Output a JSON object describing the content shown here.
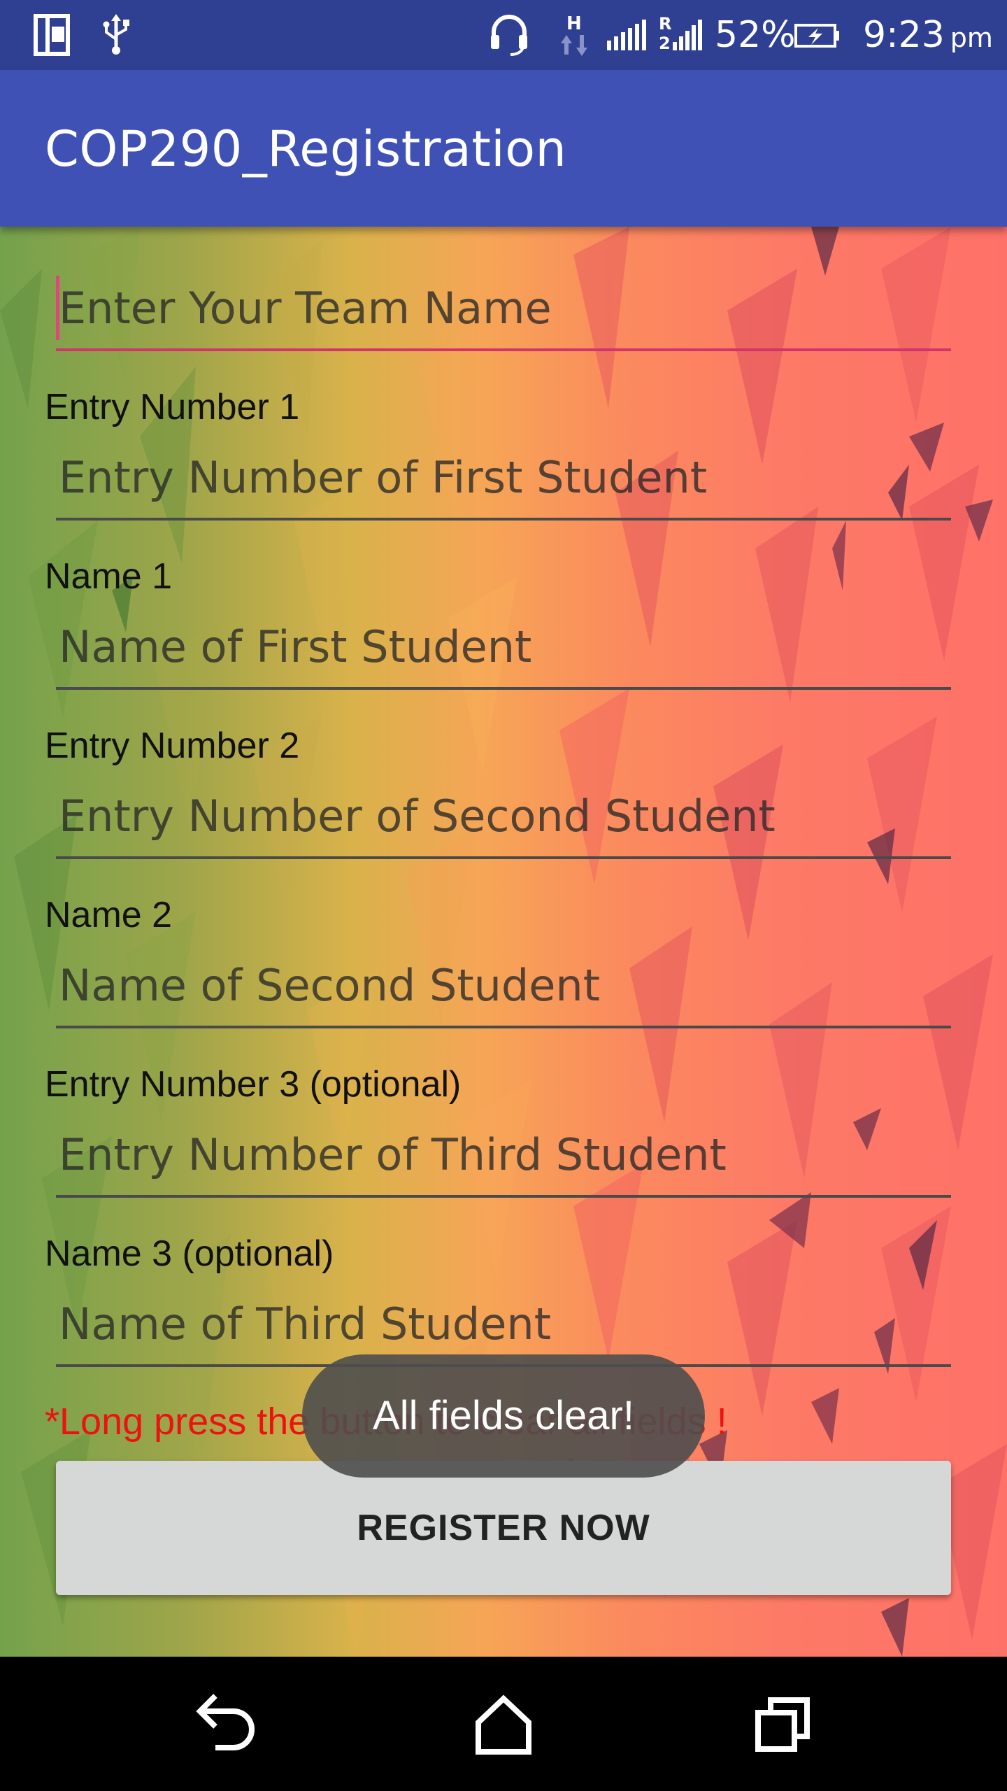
{
  "status_bar": {
    "battery_percent": "52%",
    "time": "9:23",
    "ampm": "pm",
    "icons": [
      "multi-window-icon",
      "usb-icon",
      "headset-icon",
      "h-data-icon",
      "signal-icon",
      "signal-r-icon",
      "battery-charging-icon"
    ]
  },
  "app_bar": {
    "title": "COP290_Registration"
  },
  "form": {
    "team_name": {
      "placeholder": "Enter Your Team Name"
    },
    "entry1": {
      "label": "Entry Number 1",
      "placeholder": "Entry Number of First Student"
    },
    "name1": {
      "label": "Name 1",
      "placeholder": "Name of First Student"
    },
    "entry2": {
      "label": "Entry Number 2",
      "placeholder": "Entry Number of Second Student"
    },
    "name2": {
      "label": "Name 2",
      "placeholder": "Name of Second Student"
    },
    "entry3": {
      "label": "Entry Number 3 (optional)",
      "placeholder": "Entry Number of Third Student"
    },
    "name3": {
      "label": "Name 3 (optional)",
      "placeholder": "Name of Third Student"
    },
    "hint": "*Long press the button to clear all fields !",
    "register_label": "REGISTER NOW"
  },
  "toast": {
    "message": "All fields clear!"
  },
  "nav_bar": {
    "icons": [
      "back-icon",
      "home-icon",
      "recents-icon"
    ]
  },
  "colors": {
    "status_bar": "#2f3f92",
    "app_bar": "#3f51b5",
    "focus_accent": "#d1356b",
    "hint_text": "#ee1111",
    "button_bg": "#d6d7d7",
    "toast_bg": "#4e4e4e"
  }
}
